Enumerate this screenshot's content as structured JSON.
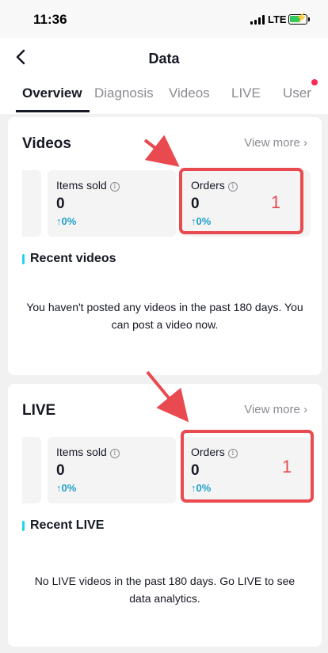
{
  "status_bar": {
    "time": "11:36",
    "network": "LTE"
  },
  "header": {
    "title": "Data",
    "tabs": [
      "Overview",
      "Diagnosis",
      "Videos",
      "LIVE",
      "User"
    ]
  },
  "videos_card": {
    "title": "Videos",
    "view_more": "View more",
    "metrics": [
      {
        "label": "Items sold",
        "value": "0",
        "change": "0%"
      },
      {
        "label": "Orders",
        "value": "0",
        "change": "0%"
      }
    ],
    "annotation": "1",
    "recent_title": "Recent videos",
    "empty_text": "You haven't posted any videos in the past 180 days. You can post a video now."
  },
  "live_card": {
    "title": "LIVE",
    "view_more": "View more",
    "metrics": [
      {
        "label": "Items sold",
        "value": "0",
        "change": "0%"
      },
      {
        "label": "Orders",
        "value": "0",
        "change": "0%"
      }
    ],
    "annotation": "1",
    "recent_title": "Recent LIVE",
    "empty_text": "No LIVE videos in the past 180 days. Go LIVE to see data analytics."
  },
  "colors": {
    "accent": "#20d5ec",
    "change": "#20a0c8",
    "annotation": "#e94a4f",
    "notification": "#fe2c55"
  }
}
